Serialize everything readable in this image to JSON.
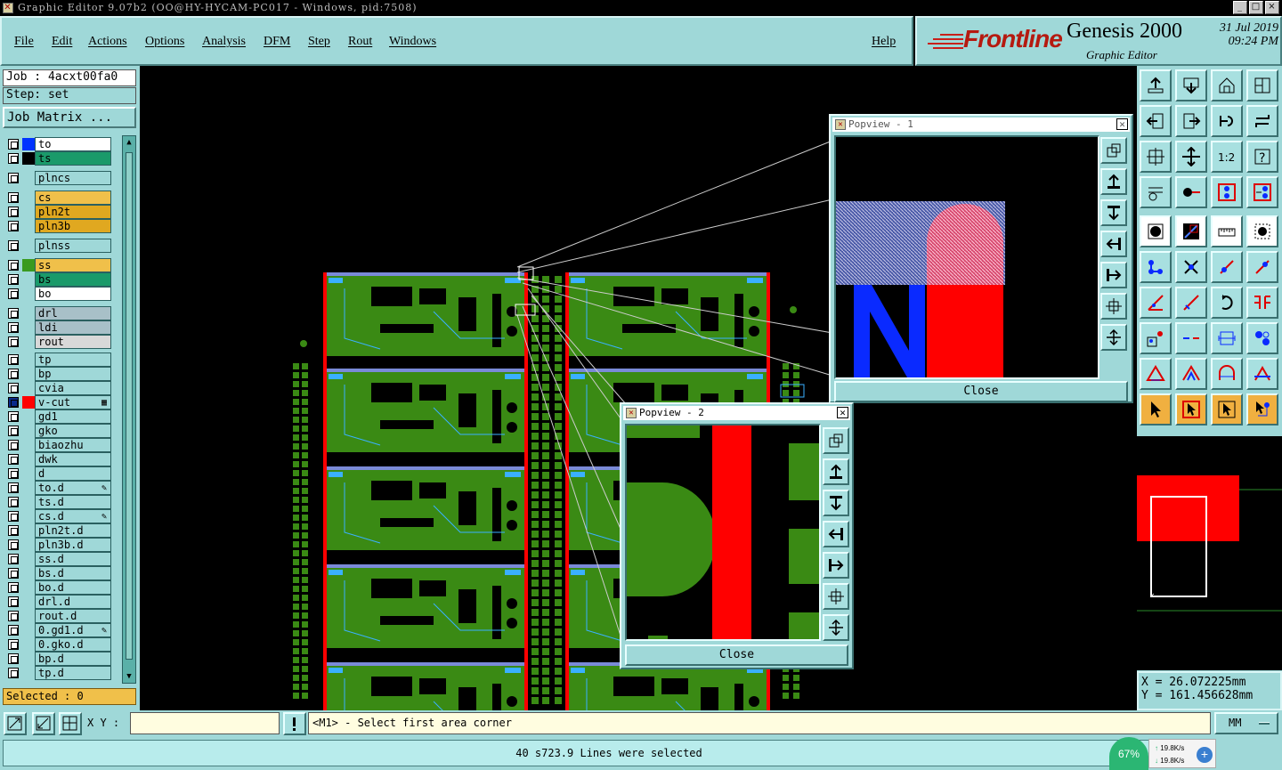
{
  "window": {
    "title": "Graphic Editor 9.07b2 (OO@HY-HYCAM-PC017 - Windows, pid:7508)"
  },
  "menu": {
    "file": "File",
    "edit": "Edit",
    "actions": "Actions",
    "options": "Options",
    "analysis": "Analysis",
    "dfm": "DFM",
    "step": "Step",
    "rout": "Rout",
    "windows": "Windows",
    "help": "Help"
  },
  "brand": {
    "logo": "Frontline",
    "product": "Genesis 2000",
    "subtitle": "Graphic Editor",
    "date": "31 Jul 2019",
    "time": "09:24 PM"
  },
  "job": {
    "job_label": "Job : 4acxt00fa0",
    "step_label": "Step: set",
    "matrix_button": "Job Matrix ..."
  },
  "layers": [
    {
      "name": "to",
      "bg": "#ffffff",
      "swatch": "#0033ff",
      "mark": ""
    },
    {
      "name": "ts",
      "bg": "#1a9a6a",
      "swatch": "#000000",
      "mark": ""
    },
    {
      "name": "plncs",
      "bg": "#9fd8d8",
      "swatch": "",
      "mark": ""
    },
    {
      "name": "cs",
      "bg": "#f0c04a",
      "swatch": "",
      "mark": ""
    },
    {
      "name": "pln2t",
      "bg": "#e0a820",
      "swatch": "",
      "mark": ""
    },
    {
      "name": "pln3b",
      "bg": "#e0a820",
      "swatch": "",
      "mark": ""
    },
    {
      "name": "plnss",
      "bg": "#9fd8d8",
      "swatch": "",
      "mark": ""
    },
    {
      "name": "ss",
      "bg": "#f0c04a",
      "swatch": "#3a9a20",
      "mark": ""
    },
    {
      "name": "bs",
      "bg": "#1a9a6a",
      "swatch": "",
      "mark": ""
    },
    {
      "name": "bo",
      "bg": "#ffffff",
      "swatch": "",
      "mark": ""
    },
    {
      "name": "drl",
      "bg": "#a8c0c8",
      "swatch": "",
      "mark": ""
    },
    {
      "name": "ldi",
      "bg": "#a8c0c8",
      "swatch": "",
      "mark": ""
    },
    {
      "name": "rout",
      "bg": "#d8d8d8",
      "swatch": "",
      "mark": ""
    },
    {
      "name": "tp",
      "bg": "#9fd8d8",
      "swatch": "",
      "mark": ""
    },
    {
      "name": "bp",
      "bg": "#9fd8d8",
      "swatch": "",
      "mark": ""
    },
    {
      "name": "cvia",
      "bg": "#9fd8d8",
      "swatch": "",
      "mark": ""
    },
    {
      "name": "v-cut",
      "bg": "#9fd8d8",
      "swatch": "#ff0000",
      "mark": "▦"
    },
    {
      "name": "gd1",
      "bg": "#9fd8d8",
      "swatch": "",
      "mark": ""
    },
    {
      "name": "gko",
      "bg": "#9fd8d8",
      "swatch": "",
      "mark": ""
    },
    {
      "name": "biaozhu",
      "bg": "#9fd8d8",
      "swatch": "",
      "mark": ""
    },
    {
      "name": "dwk",
      "bg": "#9fd8d8",
      "swatch": "",
      "mark": ""
    },
    {
      "name": "d",
      "bg": "#9fd8d8",
      "swatch": "",
      "mark": ""
    },
    {
      "name": "to.d",
      "bg": "#9fd8d8",
      "swatch": "",
      "mark": "✎"
    },
    {
      "name": "ts.d",
      "bg": "#9fd8d8",
      "swatch": "",
      "mark": ""
    },
    {
      "name": "cs.d",
      "bg": "#9fd8d8",
      "swatch": "",
      "mark": "✎"
    },
    {
      "name": "pln2t.d",
      "bg": "#9fd8d8",
      "swatch": "",
      "mark": ""
    },
    {
      "name": "pln3b.d",
      "bg": "#9fd8d8",
      "swatch": "",
      "mark": ""
    },
    {
      "name": "ss.d",
      "bg": "#9fd8d8",
      "swatch": "",
      "mark": ""
    },
    {
      "name": "bs.d",
      "bg": "#9fd8d8",
      "swatch": "",
      "mark": ""
    },
    {
      "name": "bo.d",
      "bg": "#9fd8d8",
      "swatch": "",
      "mark": ""
    },
    {
      "name": "drl.d",
      "bg": "#9fd8d8",
      "swatch": "",
      "mark": ""
    },
    {
      "name": "rout.d",
      "bg": "#9fd8d8",
      "swatch": "",
      "mark": ""
    },
    {
      "name": "0.gd1.d",
      "bg": "#9fd8d8",
      "swatch": "",
      "mark": "✎"
    },
    {
      "name": "0.gko.d",
      "bg": "#9fd8d8",
      "swatch": "",
      "mark": ""
    },
    {
      "name": "bp.d",
      "bg": "#9fd8d8",
      "swatch": "",
      "mark": ""
    },
    {
      "name": "tp.d",
      "bg": "#9fd8d8",
      "swatch": "",
      "mark": ""
    }
  ],
  "selection": {
    "label": "Selected : 0"
  },
  "popview1": {
    "title": "Popview - 1",
    "close": "Close"
  },
  "popview2": {
    "title": "Popview - 2",
    "close": "Close"
  },
  "coords": {
    "x": "X  = 26.072225mm",
    "y": "Y  = 161.456628mm"
  },
  "command": {
    "xy_label": "X Y :",
    "xy_value": "",
    "message": "<M1> - Select first area corner",
    "units": "MM"
  },
  "status": {
    "message": "40 s723.9 Lines were selected",
    "net_percent": "67%",
    "upload": "19.8K/s",
    "download": "19.8K/s"
  },
  "colors": {
    "panel": "#9fd8d8",
    "copper": "#3a8a14",
    "vcut": "#ff0000",
    "pad": "#3ab0ff"
  }
}
